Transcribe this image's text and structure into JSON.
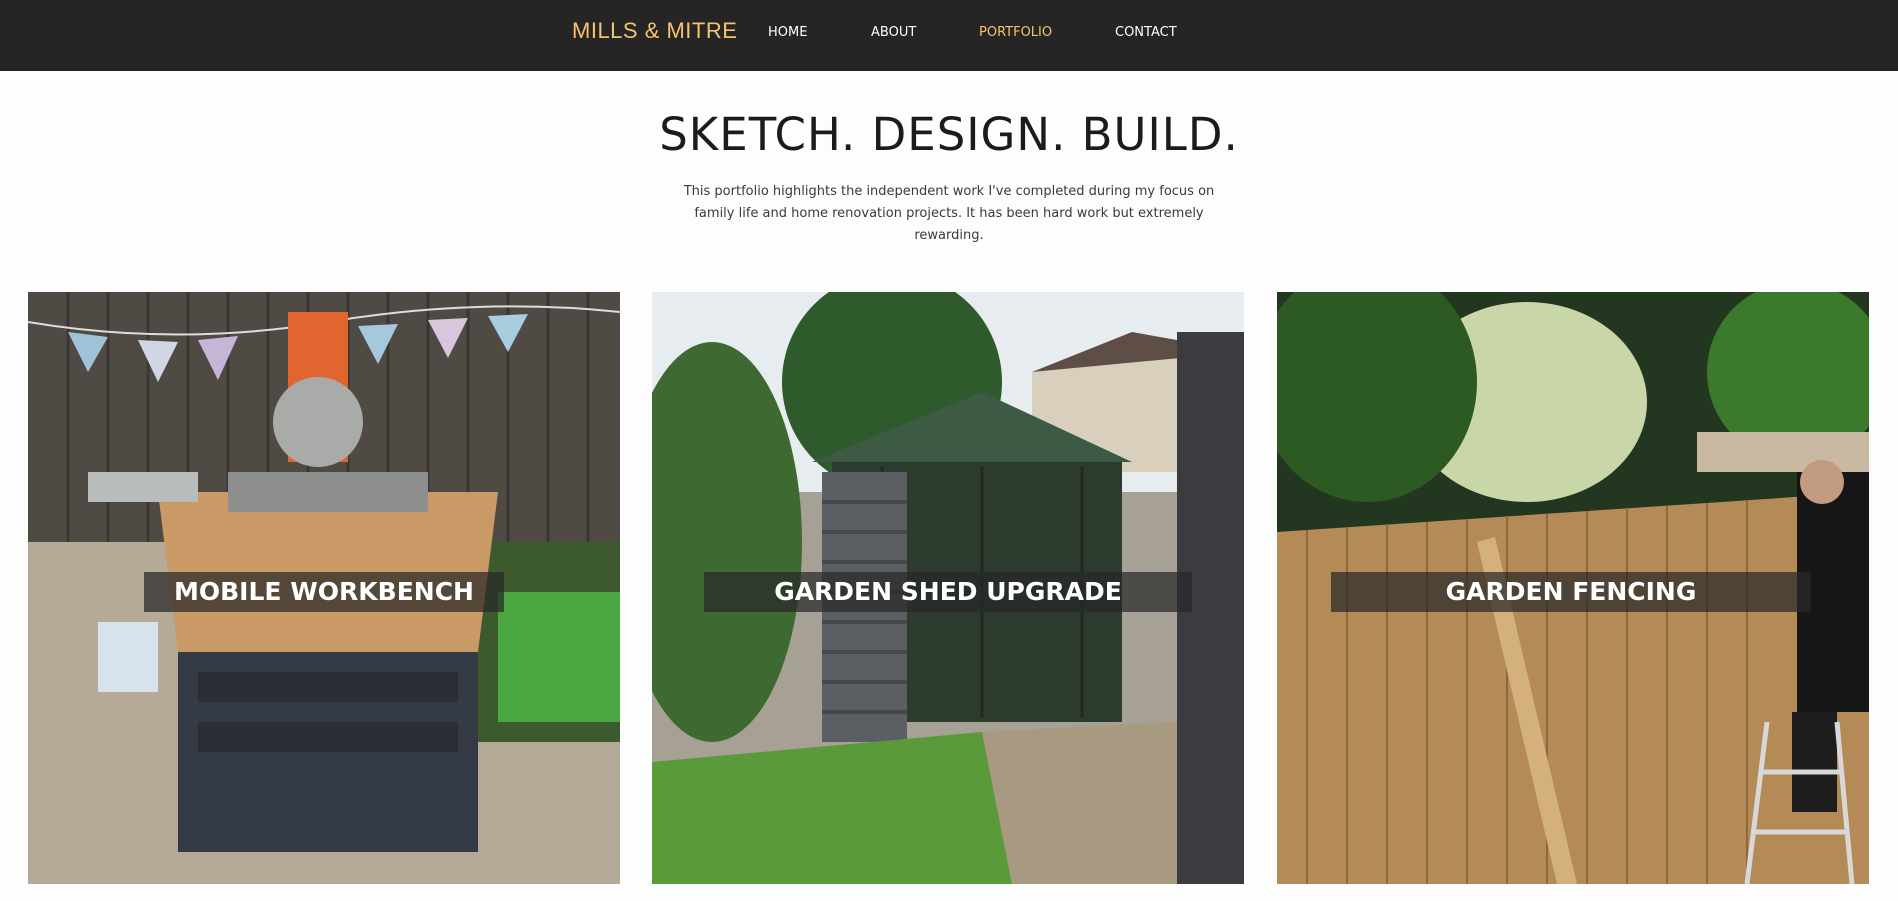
{
  "nav": {
    "brand": "MILLS & MITRE",
    "links": [
      "HOME",
      "ABOUT",
      "PORTFOLIO",
      "CONTACT"
    ],
    "active": "PORTFOLIO"
  },
  "hero": {
    "title": "SKETCH. DESIGN. BUILD.",
    "text": "This portfolio highlights the independent work I've completed during my focus on family life and home renovation projects. It has been hard work but extremely rewarding."
  },
  "projects": [
    {
      "title": "MOBILE WORKBENCH"
    },
    {
      "title": "GARDEN SHED UPGRADE"
    },
    {
      "title": "GARDEN FENCING"
    }
  ],
  "colors": {
    "navbar_bg": "#252525",
    "accent": "#f5c36d",
    "page_bg": "#fdfdfd"
  }
}
